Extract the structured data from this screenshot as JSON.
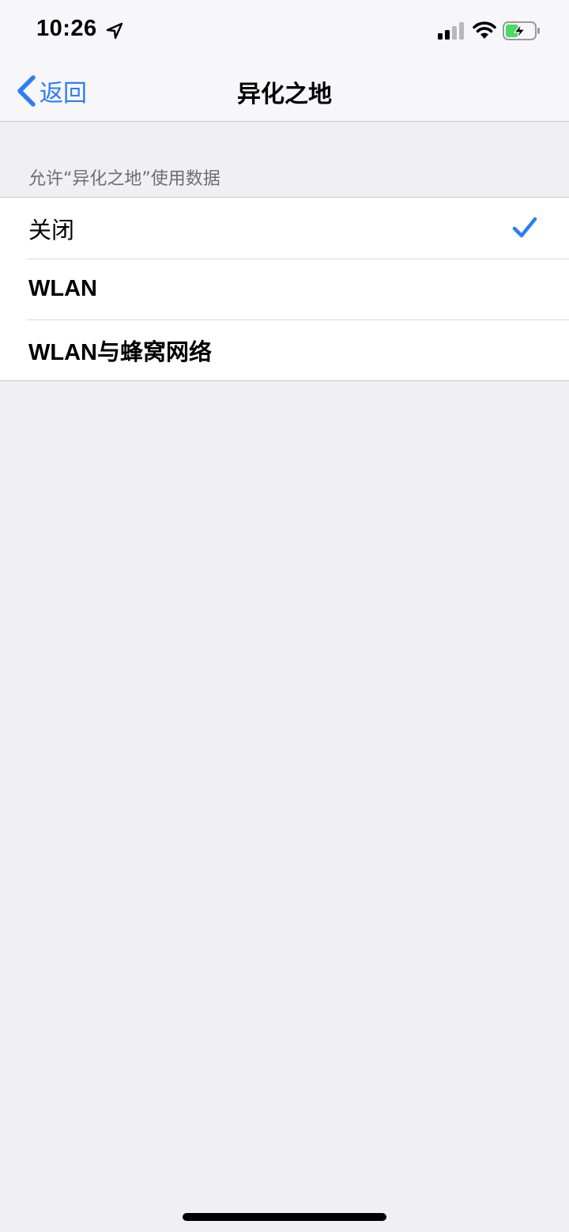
{
  "status_bar": {
    "time": "10:26",
    "icons": [
      "location-arrow-icon",
      "cellular-signal-icon",
      "wifi-icon",
      "battery-charging-icon"
    ]
  },
  "nav": {
    "back_label": "返回",
    "title": "异化之地"
  },
  "section": {
    "header": "允许“异化之地”使用数据",
    "options": [
      {
        "label": "关闭",
        "selected": true
      },
      {
        "label": "WLAN",
        "selected": false
      },
      {
        "label": "WLAN与蜂窝网络",
        "selected": false
      }
    ]
  },
  "colors": {
    "accent": "#2e7cf6",
    "background": "#efeff4",
    "battery_fill": "#4cd964"
  }
}
